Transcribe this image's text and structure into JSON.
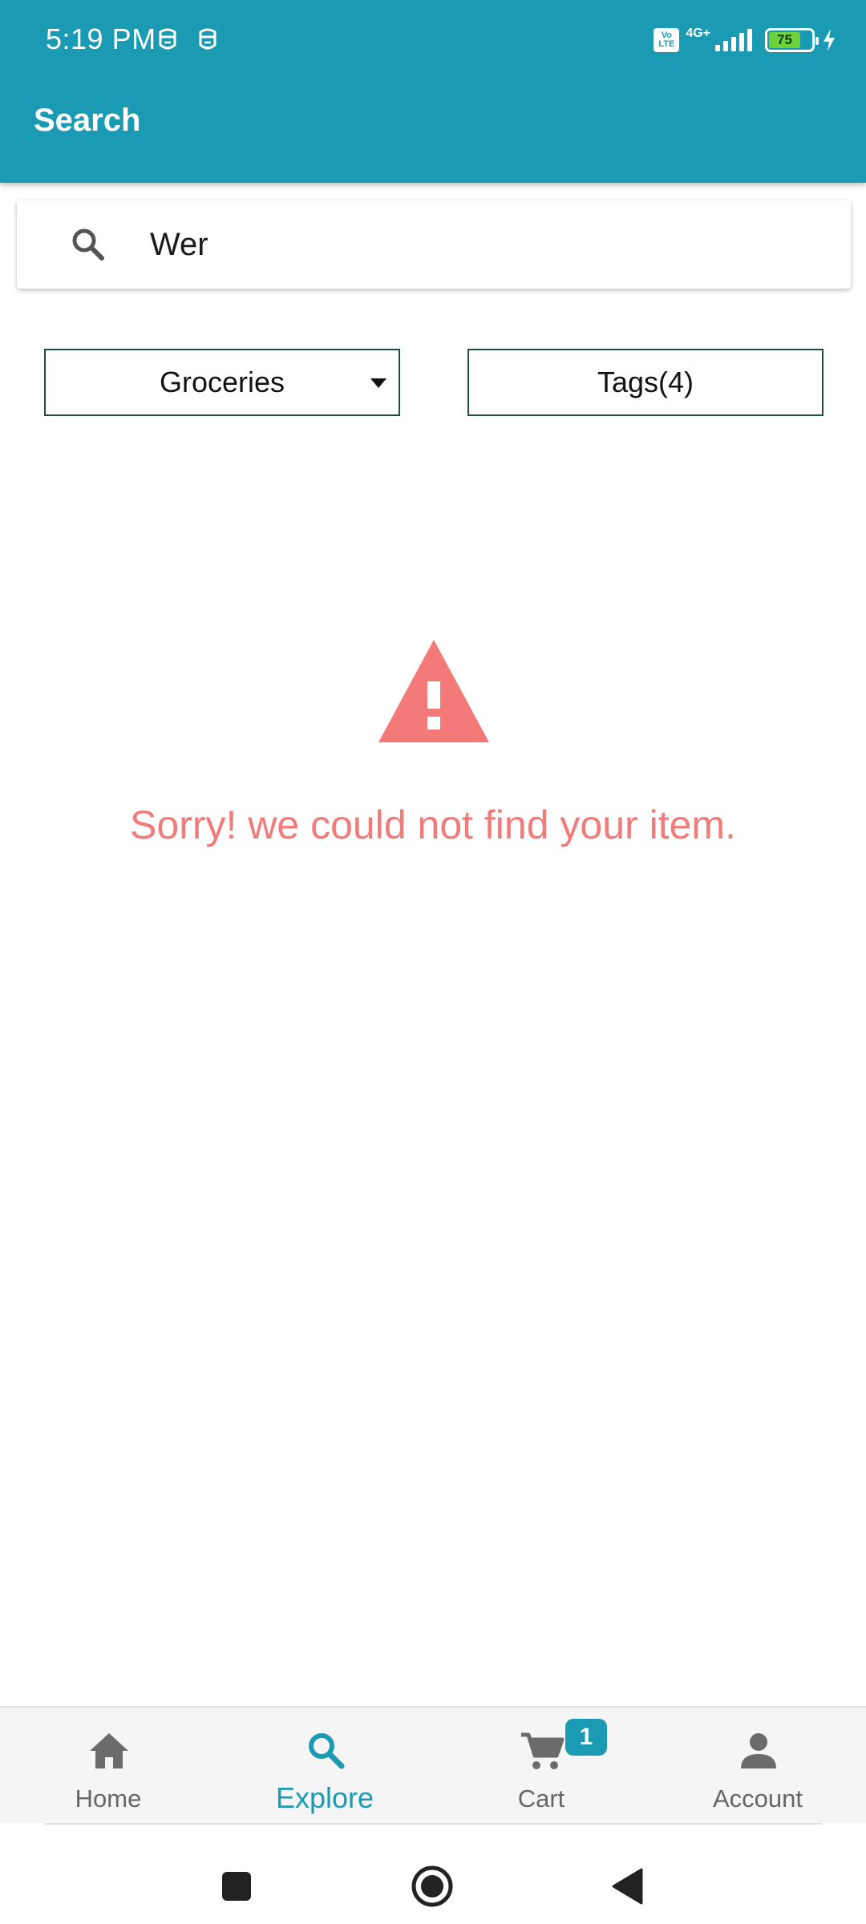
{
  "status_bar": {
    "time": "5:19 PM",
    "network": "4G+",
    "volte_line1": "Vo",
    "volte_line2": "LTE",
    "battery": "75",
    "battery_level_percent": 75,
    "icons": [
      "notification-face-icon",
      "notification-face-icon",
      "volte-icon",
      "signal-icon",
      "battery-icon",
      "charging-bolt-icon"
    ]
  },
  "app_bar": {
    "title": "Search"
  },
  "search": {
    "value": "Wer",
    "icon": "search-icon"
  },
  "filters": {
    "category_label": "Groceries",
    "tags_label": "Tags(4)"
  },
  "empty_state": {
    "icon": "warning-triangle-icon",
    "message": "Sorry! we could not find your item."
  },
  "bottom_nav": {
    "items": [
      {
        "label": "Home",
        "icon": "home-icon",
        "active": false
      },
      {
        "label": "Explore",
        "icon": "search-icon",
        "active": true
      },
      {
        "label": "Cart",
        "icon": "cart-icon",
        "active": false,
        "badge": "1"
      },
      {
        "label": "Account",
        "icon": "account-icon",
        "active": false
      }
    ]
  },
  "system_nav": {
    "icons": [
      "recents-square-icon",
      "home-circle-icon",
      "back-triangle-icon"
    ]
  },
  "colors": {
    "primary": "#1a9ab3",
    "error": "#f07b7b",
    "filter_border": "#1e4d3a",
    "nav_background": "#f5f5f5",
    "battery_fill": "#6cd43a"
  }
}
